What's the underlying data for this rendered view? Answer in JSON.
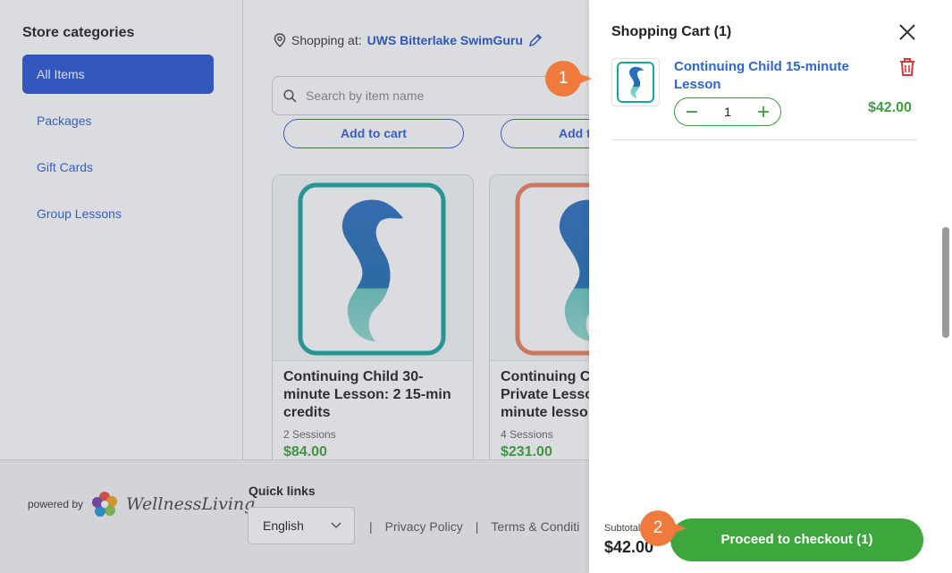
{
  "sidebar": {
    "heading": "Store categories",
    "items": [
      {
        "label": "All Items",
        "active": true
      },
      {
        "label": "Packages",
        "active": false
      },
      {
        "label": "Gift Cards",
        "active": false
      },
      {
        "label": "Group Lessons",
        "active": false
      }
    ]
  },
  "location": {
    "prefix": "Shopping at:",
    "name": "UWS Bitterlake SwimGuru"
  },
  "search": {
    "placeholder": "Search by item name"
  },
  "add_to_cart_labels": [
    "Add to cart",
    "Add t"
  ],
  "cards": [
    {
      "title": "Continuing Child 30-minute Lesson: 2 15-min credits",
      "sessions": "2 Sessions",
      "price": "$84.00",
      "frame_color": "#1aa5a0"
    },
    {
      "title": "Continuing Ch... Private Lesso... minute lesson...",
      "title_lines": [
        "Continuing Ch",
        "Private Lesso",
        "minute lesso"
      ],
      "sessions": "4 Sessions",
      "price": "$231.00",
      "frame_color": "#e8805f"
    }
  ],
  "footer": {
    "powered_by": "powered by",
    "brand": "WellnessLiving",
    "quick_links": "Quick links",
    "language": "English",
    "links": [
      "|",
      "Privacy Policy",
      "|",
      "Terms & Conditi"
    ]
  },
  "cart": {
    "title": "Shopping Cart (1)",
    "item": {
      "name": "Continuing Child 15-minute Lesson",
      "quantity": "1",
      "price": "$42.00"
    },
    "subtotal_label": "Subtotal",
    "subtotal_value": "$42.00",
    "checkout_label": "Proceed to checkout (1)"
  },
  "callouts": [
    "1",
    "2"
  ],
  "icons": [
    "location-pin-icon",
    "edit-pencil-icon",
    "search-icon",
    "close-icon",
    "trash-icon",
    "minus-icon",
    "plus-icon",
    "chevron-down-icon",
    "seahorse-logo-icon",
    "wellnessliving-flower-icon"
  ],
  "colors": {
    "primary": "#2756d8",
    "green": "#3da63d",
    "price_green": "#3aa33a",
    "delete_red": "#d43a3a",
    "callout": "#ef7a3c"
  }
}
